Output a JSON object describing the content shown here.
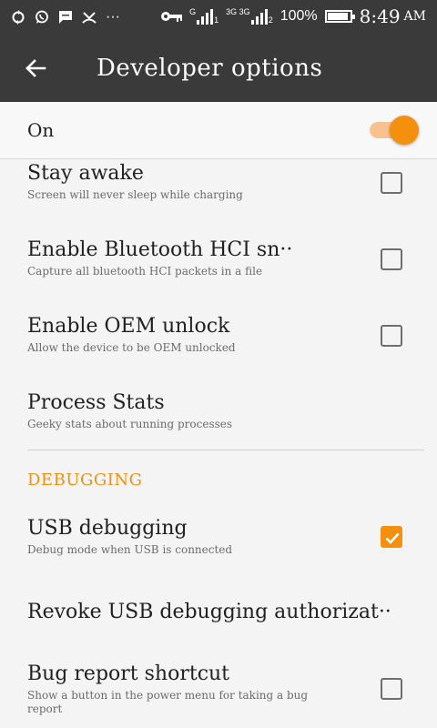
{
  "status_bar": {
    "left_icons": [
      "sync-icon",
      "whatsapp-icon",
      "message-icon",
      "missed-call-icon",
      "more-notifications-icon"
    ],
    "more_dots": "···",
    "sim1_label": "G",
    "sim1_index": "1",
    "sim2_label": "3G 3G",
    "sim2_index": "2",
    "battery_percent_text": "100%",
    "battery_level": 1.0,
    "time": "8:49",
    "ampm": "AM"
  },
  "app_bar": {
    "title": "Developer options",
    "back_icon": "arrow-back-icon"
  },
  "master_switch": {
    "label": "On",
    "enabled": true
  },
  "settings": [
    {
      "title": "Stay awake",
      "subtitle": "Screen will never sleep while charging",
      "checked": false
    },
    {
      "title": "Enable Bluetooth HCI sn··",
      "subtitle": "Capture all bluetooth HCI packets in a file",
      "checked": false
    },
    {
      "title": "Enable OEM unlock",
      "subtitle": "Allow the device to be OEM unlocked",
      "checked": false
    },
    {
      "title": "Process Stats",
      "subtitle": "Geeky stats about running processes"
    }
  ],
  "debugging": {
    "header": "DEBUGGING",
    "items": [
      {
        "title": "USB debugging",
        "subtitle": "Debug mode when USB is connected",
        "checked": true
      },
      {
        "title": "Revoke USB debugging authorizat··"
      },
      {
        "title": "Bug report shortcut",
        "subtitle": "Show a button in the power menu for taking a bug report",
        "checked": false
      }
    ]
  },
  "colors": {
    "accent": "#f5900f",
    "toolbar": "#3a3a3a",
    "background": "#f4f4f4"
  }
}
